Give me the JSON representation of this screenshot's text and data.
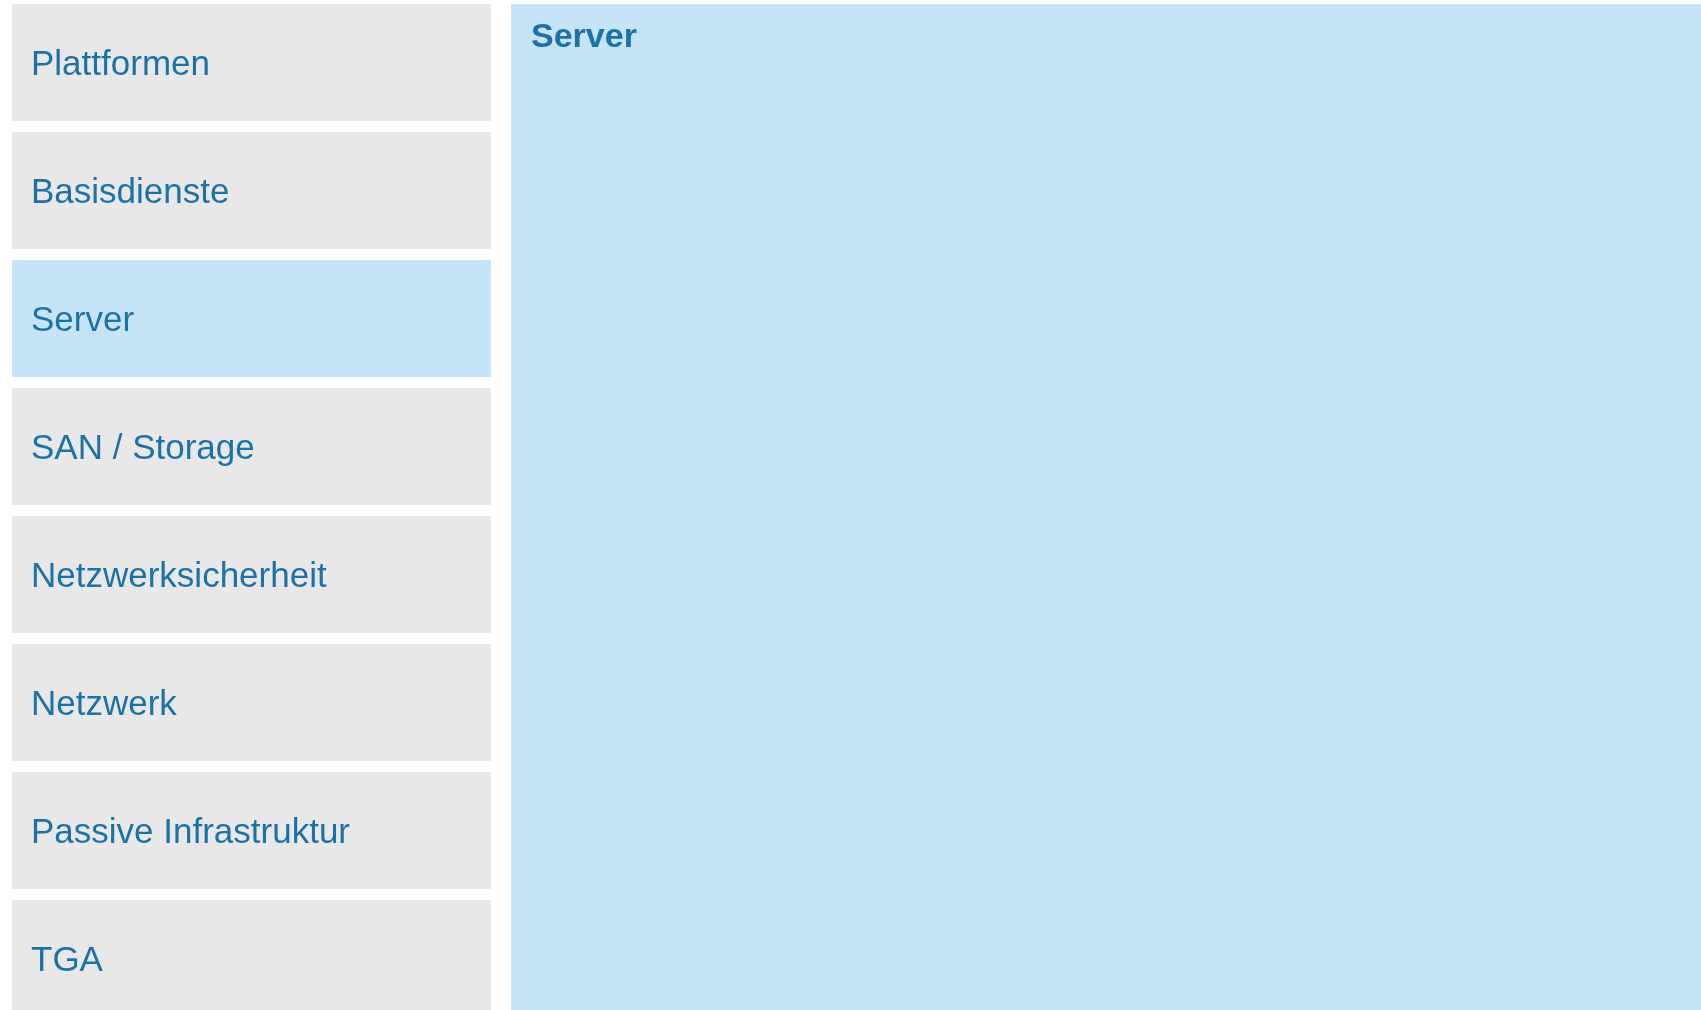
{
  "sidebar": {
    "items": [
      {
        "label": "Plattformen",
        "selected": false
      },
      {
        "label": "Basisdienste",
        "selected": false
      },
      {
        "label": "Server",
        "selected": true
      },
      {
        "label": "SAN / Storage",
        "selected": false
      },
      {
        "label": "Netzwerksicherheit",
        "selected": false
      },
      {
        "label": "Netzwerk",
        "selected": false
      },
      {
        "label": "Passive Infrastruktur",
        "selected": false
      },
      {
        "label": "TGA",
        "selected": false
      }
    ]
  },
  "panel": {
    "title": "Server"
  }
}
